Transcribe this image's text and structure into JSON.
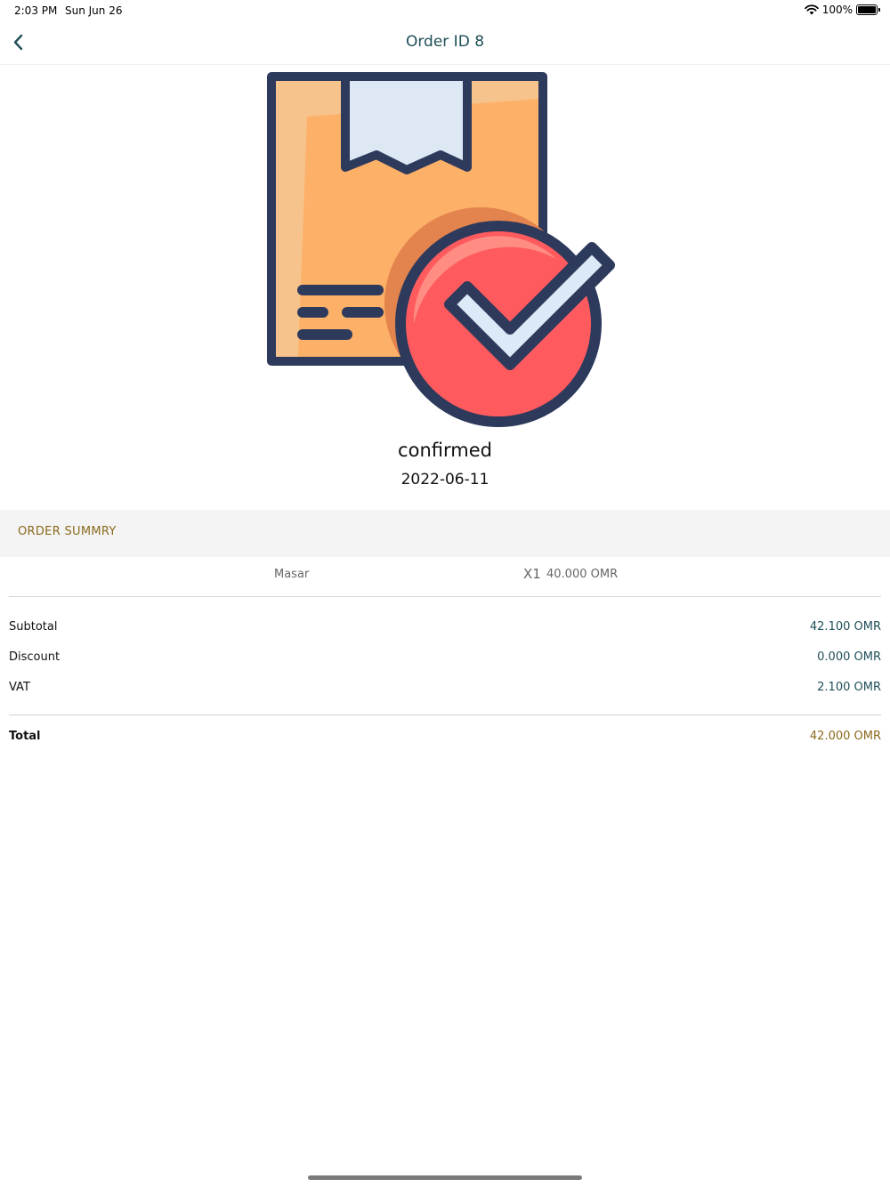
{
  "status_bar": {
    "time": "2:03 PM",
    "date": "Sun Jun 26",
    "battery": "100%"
  },
  "nav": {
    "title": "Order ID 8",
    "back_icon": "chevron-left-icon"
  },
  "order": {
    "status": "confirmed",
    "date": "2022-06-11"
  },
  "summary": {
    "title": "ORDER SUMMRY",
    "items": [
      {
        "name": "Masar",
        "qty": "X1",
        "price": "40.000 OMR"
      }
    ],
    "subtotal": {
      "label": "Subtotal",
      "value": "42.100 OMR"
    },
    "discount": {
      "label": "Discount",
      "value": "0.000 OMR"
    },
    "vat": {
      "label": "VAT",
      "value": "2.100 OMR"
    },
    "total": {
      "label": "Total",
      "value": "42.000 OMR"
    }
  },
  "colors": {
    "accent_teal": "#1f4f57",
    "accent_gold": "#8a6a1c"
  }
}
